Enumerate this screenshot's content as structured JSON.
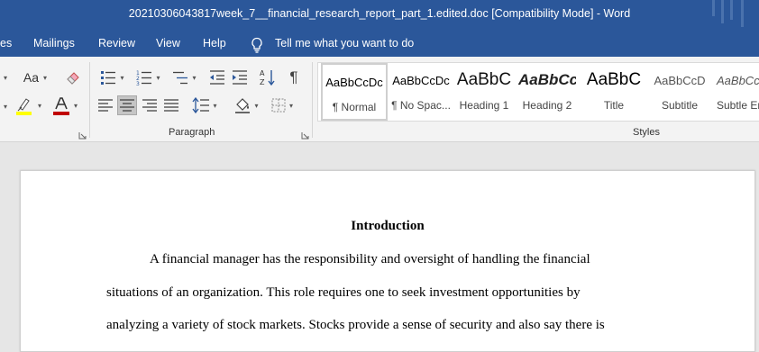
{
  "titlebar": {
    "title": "20210306043817week_7__financial_research_report_part_1.edited.doc [Compatibility Mode]  -  Word"
  },
  "tabs": [
    {
      "label": "es"
    },
    {
      "label": "Mailings"
    },
    {
      "label": "Review"
    },
    {
      "label": "View"
    },
    {
      "label": "Help"
    }
  ],
  "tell_me": {
    "label": "Tell me what you want to do"
  },
  "font_group": {
    "change_case_label": "Aa"
  },
  "groups": {
    "paragraph": "Paragraph",
    "styles": "Styles"
  },
  "styles": [
    {
      "sample": "AaBbCcDc",
      "label": "¶ Normal",
      "active": true
    },
    {
      "sample": "AaBbCcDc",
      "label": "¶ No Spac..."
    },
    {
      "sample": "AaBbC",
      "label": "Heading 1"
    },
    {
      "sample": "AaBbCc",
      "label": "Heading 2"
    },
    {
      "sample": "AaBbC",
      "label": "Title"
    },
    {
      "sample": "AaBbCcD",
      "label": "Subtitle"
    },
    {
      "sample": "AaBbCcD",
      "label": "Subtle Em"
    }
  ],
  "document": {
    "heading": "Introduction",
    "lines": [
      "A financial manager has the responsibility and oversight of handling the financial",
      "situations of an organization. This role requires one to seek investment opportunities by",
      "analyzing a variety of stock markets. Stocks provide a sense of security and also say there is"
    ]
  },
  "colors": {
    "title_bar": "#2b579a",
    "ribbon": "#f3f3f3",
    "highlight": "#ffff00",
    "font_color": "#c00000"
  }
}
